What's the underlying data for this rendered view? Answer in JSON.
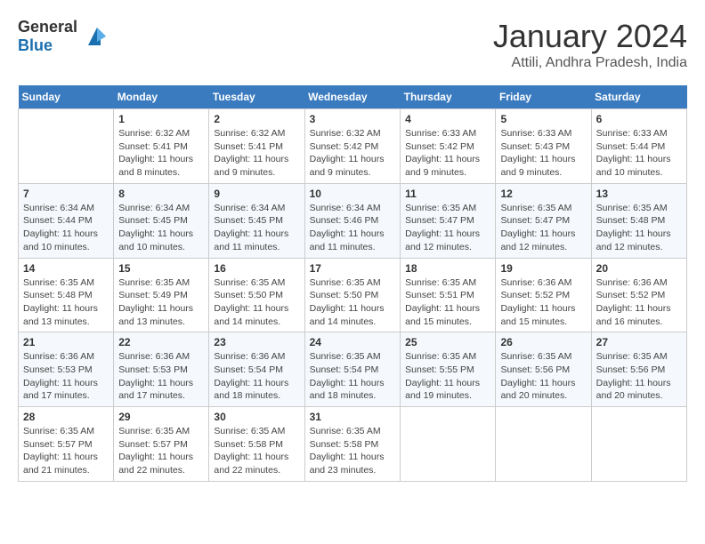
{
  "header": {
    "logo_general": "General",
    "logo_blue": "Blue",
    "month_title": "January 2024",
    "location": "Attili, Andhra Pradesh, India"
  },
  "days_of_week": [
    "Sunday",
    "Monday",
    "Tuesday",
    "Wednesday",
    "Thursday",
    "Friday",
    "Saturday"
  ],
  "weeks": [
    [
      null,
      {
        "day": "1",
        "sunrise": "6:32 AM",
        "sunset": "5:41 PM",
        "daylight": "11 hours and 8 minutes."
      },
      {
        "day": "2",
        "sunrise": "6:32 AM",
        "sunset": "5:41 PM",
        "daylight": "11 hours and 9 minutes."
      },
      {
        "day": "3",
        "sunrise": "6:32 AM",
        "sunset": "5:42 PM",
        "daylight": "11 hours and 9 minutes."
      },
      {
        "day": "4",
        "sunrise": "6:33 AM",
        "sunset": "5:42 PM",
        "daylight": "11 hours and 9 minutes."
      },
      {
        "day": "5",
        "sunrise": "6:33 AM",
        "sunset": "5:43 PM",
        "daylight": "11 hours and 9 minutes."
      },
      {
        "day": "6",
        "sunrise": "6:33 AM",
        "sunset": "5:44 PM",
        "daylight": "11 hours and 10 minutes."
      }
    ],
    [
      {
        "day": "7",
        "sunrise": "6:34 AM",
        "sunset": "5:44 PM",
        "daylight": "11 hours and 10 minutes."
      },
      {
        "day": "8",
        "sunrise": "6:34 AM",
        "sunset": "5:45 PM",
        "daylight": "11 hours and 10 minutes."
      },
      {
        "day": "9",
        "sunrise": "6:34 AM",
        "sunset": "5:45 PM",
        "daylight": "11 hours and 11 minutes."
      },
      {
        "day": "10",
        "sunrise": "6:34 AM",
        "sunset": "5:46 PM",
        "daylight": "11 hours and 11 minutes."
      },
      {
        "day": "11",
        "sunrise": "6:35 AM",
        "sunset": "5:47 PM",
        "daylight": "11 hours and 12 minutes."
      },
      {
        "day": "12",
        "sunrise": "6:35 AM",
        "sunset": "5:47 PM",
        "daylight": "11 hours and 12 minutes."
      },
      {
        "day": "13",
        "sunrise": "6:35 AM",
        "sunset": "5:48 PM",
        "daylight": "11 hours and 12 minutes."
      }
    ],
    [
      {
        "day": "14",
        "sunrise": "6:35 AM",
        "sunset": "5:48 PM",
        "daylight": "11 hours and 13 minutes."
      },
      {
        "day": "15",
        "sunrise": "6:35 AM",
        "sunset": "5:49 PM",
        "daylight": "11 hours and 13 minutes."
      },
      {
        "day": "16",
        "sunrise": "6:35 AM",
        "sunset": "5:50 PM",
        "daylight": "11 hours and 14 minutes."
      },
      {
        "day": "17",
        "sunrise": "6:35 AM",
        "sunset": "5:50 PM",
        "daylight": "11 hours and 14 minutes."
      },
      {
        "day": "18",
        "sunrise": "6:35 AM",
        "sunset": "5:51 PM",
        "daylight": "11 hours and 15 minutes."
      },
      {
        "day": "19",
        "sunrise": "6:36 AM",
        "sunset": "5:52 PM",
        "daylight": "11 hours and 15 minutes."
      },
      {
        "day": "20",
        "sunrise": "6:36 AM",
        "sunset": "5:52 PM",
        "daylight": "11 hours and 16 minutes."
      }
    ],
    [
      {
        "day": "21",
        "sunrise": "6:36 AM",
        "sunset": "5:53 PM",
        "daylight": "11 hours and 17 minutes."
      },
      {
        "day": "22",
        "sunrise": "6:36 AM",
        "sunset": "5:53 PM",
        "daylight": "11 hours and 17 minutes."
      },
      {
        "day": "23",
        "sunrise": "6:36 AM",
        "sunset": "5:54 PM",
        "daylight": "11 hours and 18 minutes."
      },
      {
        "day": "24",
        "sunrise": "6:35 AM",
        "sunset": "5:54 PM",
        "daylight": "11 hours and 18 minutes."
      },
      {
        "day": "25",
        "sunrise": "6:35 AM",
        "sunset": "5:55 PM",
        "daylight": "11 hours and 19 minutes."
      },
      {
        "day": "26",
        "sunrise": "6:35 AM",
        "sunset": "5:56 PM",
        "daylight": "11 hours and 20 minutes."
      },
      {
        "day": "27",
        "sunrise": "6:35 AM",
        "sunset": "5:56 PM",
        "daylight": "11 hours and 20 minutes."
      }
    ],
    [
      {
        "day": "28",
        "sunrise": "6:35 AM",
        "sunset": "5:57 PM",
        "daylight": "11 hours and 21 minutes."
      },
      {
        "day": "29",
        "sunrise": "6:35 AM",
        "sunset": "5:57 PM",
        "daylight": "11 hours and 22 minutes."
      },
      {
        "day": "30",
        "sunrise": "6:35 AM",
        "sunset": "5:58 PM",
        "daylight": "11 hours and 22 minutes."
      },
      {
        "day": "31",
        "sunrise": "6:35 AM",
        "sunset": "5:58 PM",
        "daylight": "11 hours and 23 minutes."
      },
      null,
      null,
      null
    ]
  ],
  "labels": {
    "sunrise": "Sunrise:",
    "sunset": "Sunset:",
    "daylight": "Daylight:"
  }
}
